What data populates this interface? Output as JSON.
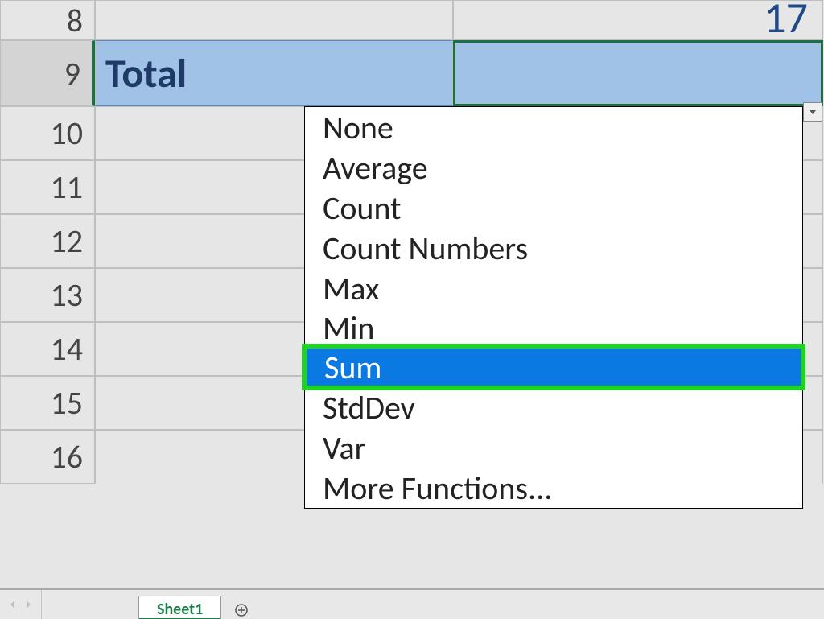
{
  "rows": {
    "visible_numbers": [
      "8",
      "9",
      "10",
      "11",
      "12",
      "13",
      "14",
      "15",
      "16"
    ],
    "r8_value": "17",
    "r9_label": "Total"
  },
  "dropdown": {
    "items": [
      {
        "label": "None"
      },
      {
        "label": "Average"
      },
      {
        "label": "Count"
      },
      {
        "label": "Count Numbers"
      },
      {
        "label": "Max"
      },
      {
        "label": "Min"
      },
      {
        "label": "Sum",
        "selected": true
      },
      {
        "label": "StdDev"
      },
      {
        "label": "Var"
      },
      {
        "label": "More Functions..."
      }
    ]
  },
  "tabs": {
    "active": "Sheet1"
  }
}
